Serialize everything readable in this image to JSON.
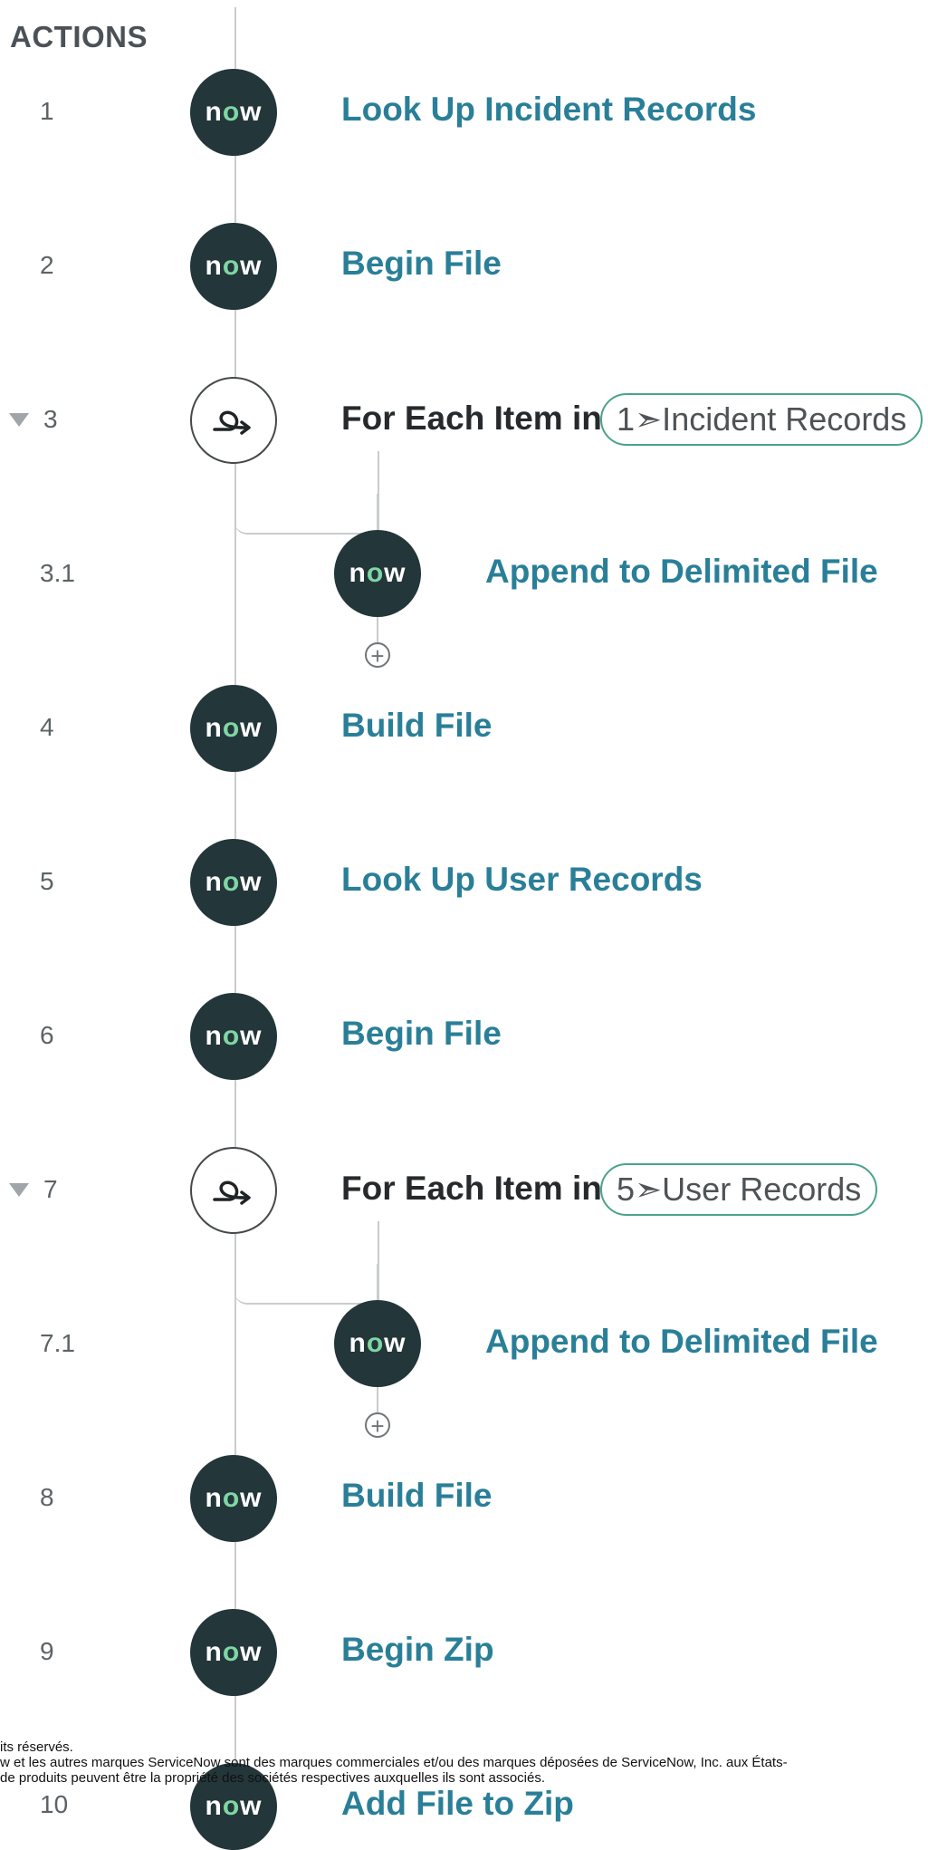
{
  "header": {
    "title": "ACTIONS"
  },
  "steps": [
    {
      "num": "1",
      "type": "action",
      "title": "Look Up Incident Records"
    },
    {
      "num": "2",
      "type": "action",
      "title": "Begin File"
    },
    {
      "num": "3",
      "type": "loop",
      "title": "For Each Item in",
      "pill": "1➣Incident Records",
      "collapsible": true
    },
    {
      "num": "3.1",
      "type": "action",
      "title": "Append to Delimited File",
      "nested": true
    },
    {
      "num": "4",
      "type": "action",
      "title": "Build File"
    },
    {
      "num": "5",
      "type": "action",
      "title": "Look Up User Records"
    },
    {
      "num": "6",
      "type": "action",
      "title": "Begin File"
    },
    {
      "num": "7",
      "type": "loop",
      "title": "For Each Item in",
      "pill": "5➣User Records",
      "collapsible": true
    },
    {
      "num": "7.1",
      "type": "action",
      "title": "Append to Delimited File",
      "nested": true
    },
    {
      "num": "8",
      "type": "action",
      "title": "Build File"
    },
    {
      "num": "9",
      "type": "action",
      "title": "Begin Zip"
    },
    {
      "num": "10",
      "type": "action",
      "title": "Add File to Zip"
    }
  ],
  "node_logo": {
    "before": "n",
    "o": "o",
    "after": "w"
  },
  "add_button": {
    "symbol": "+"
  },
  "footer": {
    "line1": "its réservés.",
    "line2": "w et les autres marques ServiceNow sont des marques commerciales et/ou des marques déposées de ServiceNow, Inc. aux États-",
    "line3": "de produits peuvent être la propriété des sociétés respectives auxquelles ils sont associés."
  },
  "colors": {
    "action_text": "#2a7f98",
    "node_bg": "#23363a",
    "logo_o": "#7fd6a4",
    "pill_border": "#4aa38b",
    "connector": "#c9cccd"
  }
}
